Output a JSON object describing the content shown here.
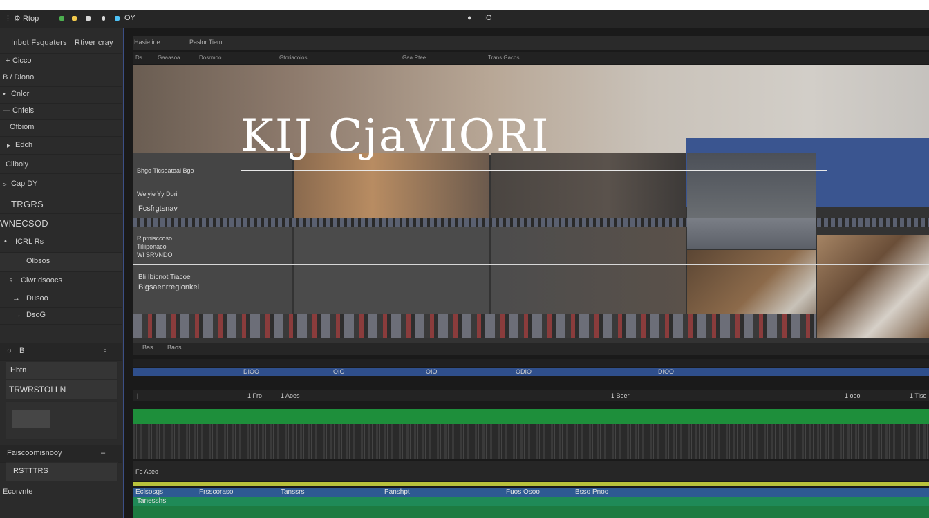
{
  "titlebar": {
    "app_menu": "Rtop",
    "right_label": "IO",
    "mid_label": "OY",
    "accent_colors": [
      "#4caf50",
      "#f2c94c",
      "#e0e0e0",
      "#4fc3f7"
    ]
  },
  "sidebar": {
    "header_left": "Inbot Fsquaters",
    "header_right": "Rtiver cray",
    "items": [
      {
        "label": "Cicco"
      },
      {
        "label": "B / Diono"
      },
      {
        "label": "Cnlor"
      },
      {
        "label": "Cnfeis"
      },
      {
        "label": "Ofbiom"
      },
      {
        "label": "Edch"
      },
      {
        "label": "Ciiboiy"
      },
      {
        "label": "Cap DY"
      },
      {
        "label": "TRGRS"
      },
      {
        "label": "WNECSOD"
      },
      {
        "label": "ICRL Rs"
      },
      {
        "label": "Olbsos"
      },
      {
        "label": "Clwr:dsoocs"
      },
      {
        "label": "Dusoo"
      },
      {
        "label": "DsoG"
      }
    ],
    "panel2_header": "B",
    "panel2_title": "Hbtn",
    "panel2_subtitle": "TRWRSTOI LN",
    "panel2_footer": "Faiscoomisnooy",
    "panel2_footer2": "RSTTTRS",
    "panel2_footer3": "Ecorvnte"
  },
  "viewer": {
    "header_tabs": [
      "Hasie ine",
      "Paslor Tiem"
    ],
    "sub_tabs": [
      "Ds",
      "Gaaasoa",
      "Dosrmoo",
      "Gtoriacoios",
      "Gaa Rtee",
      "Trans Gacos"
    ],
    "overlay_title": "KIJ CjaVIORI",
    "info_block_1": [
      "Bhgo Ticsoatoai Bgo",
      "Weiyie Yy Dori",
      "Fcsfrgtsnav"
    ],
    "info_block_2": [
      "Riptnisccoso",
      "Tiliiponaco",
      "Wi SRVNDO"
    ],
    "info_block_3": [
      "Bli Ibicnot Tiacoe",
      "Bigsaenrregionkei"
    ],
    "bottom_tabs": [
      "Bas",
      "Baos"
    ]
  },
  "timeline": {
    "ruler_markers": [
      "1 Fro",
      "1 Aoes",
      "1 Beer",
      "1 ooo",
      "1 Tlso"
    ],
    "blue_markers": [
      "DIOO",
      "OIO",
      "OIO",
      "ODIO",
      "DIOO"
    ],
    "lane_labels": [
      "Eclsosgs",
      "Frsscoraso",
      "Tanssrs",
      "Panshpt",
      "Fuos Osoo",
      "Bsso Pnoo",
      "Tanesshs"
    ],
    "small_label": "Fo Aseo"
  }
}
